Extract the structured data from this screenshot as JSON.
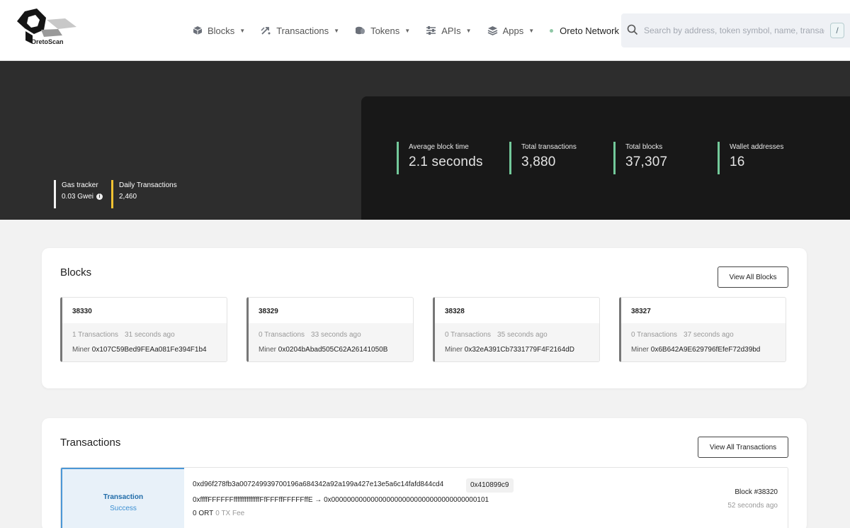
{
  "brand": {
    "name": "OretoScan"
  },
  "nav": {
    "items": [
      {
        "label": "Blocks",
        "icon": "cube-icon"
      },
      {
        "label": "Transactions",
        "icon": "arrows-icon"
      },
      {
        "label": "Tokens",
        "icon": "coins-icon"
      },
      {
        "label": "APIs",
        "icon": "sliders-icon"
      },
      {
        "label": "Apps",
        "icon": "layers-icon"
      }
    ],
    "network": "Oreto Network"
  },
  "search": {
    "placeholder": "Search by address, token symbol, name, transaction hash, or block number",
    "shortcut": "/"
  },
  "hero": {
    "gas_tracker": {
      "label": "Gas tracker",
      "value": "0.03 Gwei"
    },
    "daily_transactions": {
      "label": "Daily Transactions",
      "value": "2,460"
    },
    "stats": [
      {
        "label": "Average block time",
        "value": "2.1 seconds"
      },
      {
        "label": "Total transactions",
        "value": "3,880"
      },
      {
        "label": "Total blocks",
        "value": "37,307"
      },
      {
        "label": "Wallet addresses",
        "value": "16"
      }
    ],
    "accent_color": "#73c99a"
  },
  "blocks": {
    "title": "Blocks",
    "view_all_label": "View All Blocks",
    "items": [
      {
        "number": "38330",
        "tx_count": "1 Transactions",
        "age": "31 seconds ago",
        "miner_label": "Miner",
        "miner": "0x107C59Bed9FEAa081Fe394F1b4"
      },
      {
        "number": "38329",
        "tx_count": "0 Transactions",
        "age": "33 seconds ago",
        "miner_label": "Miner",
        "miner": "0x0204bAbad505C62A26141050B"
      },
      {
        "number": "38328",
        "tx_count": "0 Transactions",
        "age": "35 seconds ago",
        "miner_label": "Miner",
        "miner": "0x32eA391Cb7331779F4F2164dD"
      },
      {
        "number": "38327",
        "tx_count": "0 Transactions",
        "age": "37 seconds ago",
        "miner_label": "Miner",
        "miner": "0x6B642A9E629796fEfeF72d39bd"
      }
    ]
  },
  "transactions": {
    "title": "Transactions",
    "view_all_label": "View All Transactions",
    "items": [
      {
        "type": "Transaction",
        "status": "Success",
        "hash": "0xd96f278fb3a007249939700196a684342a92a199a427e13e5a6c14fafd844cd4",
        "method": "0x410899c9",
        "addresses": "0xffffFFFFFFffffffffffffffFfFFFffFFFFFffE → 0x0000000000000000000000000000000000000101",
        "value": "0 ORT",
        "fee": "0 TX Fee",
        "block": "Block #38320",
        "age": "52 seconds ago",
        "status_color": "#4b97d6"
      }
    ]
  }
}
